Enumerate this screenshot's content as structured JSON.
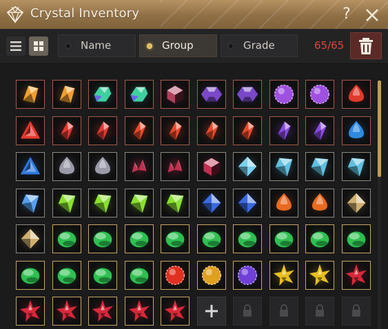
{
  "window": {
    "title": "Crystal Inventory",
    "help_label": "?",
    "icon": "diamond-gem-icon",
    "close_icon": "close-icon"
  },
  "toolbar": {
    "view_modes": [
      {
        "name": "list-view",
        "icon": "list-icon",
        "active": false
      },
      {
        "name": "grid-view",
        "icon": "grid-icon",
        "active": true
      }
    ],
    "filters": [
      {
        "label": "Name",
        "active": false
      },
      {
        "label": "Group",
        "active": true
      },
      {
        "label": "Grade",
        "active": false
      }
    ],
    "capacity": "65/65",
    "delete_icon": "trash-icon"
  },
  "colors": {
    "accent_gold": "#c09a62",
    "capacity_red": "#e0443b",
    "title_bar": "#a07f52"
  },
  "inventory": {
    "columns": 10,
    "rows": [
      [
        {
          "shape": "shard",
          "color": "#f0a030",
          "frame": "red"
        },
        {
          "shape": "shard",
          "color": "#f0a030",
          "frame": "red"
        },
        {
          "shape": "chunk",
          "color": "#3fd0a0",
          "frame": "red"
        },
        {
          "shape": "chunk",
          "color": "#3fd0a0",
          "frame": "red"
        },
        {
          "shape": "cube",
          "color": "#b0405a",
          "frame": "red"
        },
        {
          "shape": "hex",
          "color": "#7a48c8",
          "frame": "red"
        },
        {
          "shape": "hex",
          "color": "#7a48c8",
          "frame": "red"
        },
        {
          "shape": "orb",
          "color": "#a050e0",
          "frame": "red"
        },
        {
          "shape": "orb",
          "color": "#a050e0",
          "frame": "red"
        },
        {
          "shape": "drop",
          "color": "#e03a2a",
          "frame": "red"
        }
      ],
      [
        {
          "shape": "tri",
          "color": "#e8382e",
          "frame": "red"
        },
        {
          "shape": "gem",
          "color": "#e23a34",
          "frame": "red"
        },
        {
          "shape": "gem",
          "color": "#e23a34",
          "frame": "red"
        },
        {
          "shape": "gem",
          "color": "#e84a2a",
          "frame": "red"
        },
        {
          "shape": "gem",
          "color": "#e84a2a",
          "frame": "red"
        },
        {
          "shape": "gem",
          "color": "#e84a2a",
          "frame": "red"
        },
        {
          "shape": "gem",
          "color": "#e84a2a",
          "frame": "red"
        },
        {
          "shape": "gem",
          "color": "#8a4ae0",
          "frame": "red"
        },
        {
          "shape": "gem",
          "color": "#8a4ae0",
          "frame": "red"
        },
        {
          "shape": "drop",
          "color": "#2e8ae0",
          "frame": "red"
        }
      ],
      [
        {
          "shape": "tri",
          "color": "#2e7ae0",
          "frame": "gray"
        },
        {
          "shape": "drop",
          "color": "#9a9aa8",
          "frame": "gray"
        },
        {
          "shape": "drop",
          "color": "#9a9aa8",
          "frame": "gray"
        },
        {
          "shape": "cluster",
          "color": "#c03050",
          "frame": "gray"
        },
        {
          "shape": "cluster",
          "color": "#c03050",
          "frame": "gray"
        },
        {
          "shape": "cube",
          "color": "#c03050",
          "frame": "gray"
        },
        {
          "shape": "dia",
          "color": "#7ad0f0",
          "frame": "gray"
        },
        {
          "shape": "kite",
          "color": "#60c0e0",
          "frame": "gray"
        },
        {
          "shape": "kite",
          "color": "#60c0e0",
          "frame": "gray"
        },
        {
          "shape": "kite",
          "color": "#60c0e0",
          "frame": "gray"
        }
      ],
      [
        {
          "shape": "kite",
          "color": "#58a0f0",
          "frame": "gray"
        },
        {
          "shape": "kite",
          "color": "#8ae030",
          "frame": "gray"
        },
        {
          "shape": "kite",
          "color": "#8ae030",
          "frame": "gray"
        },
        {
          "shape": "kite",
          "color": "#8ae030",
          "frame": "gray"
        },
        {
          "shape": "kite",
          "color": "#8ae030",
          "frame": "gray"
        },
        {
          "shape": "dia",
          "color": "#3a6ae0",
          "frame": "gray"
        },
        {
          "shape": "dia",
          "color": "#3a6ae0",
          "frame": "gray"
        },
        {
          "shape": "drop",
          "color": "#e86a20",
          "frame": "gray"
        },
        {
          "shape": "drop",
          "color": "#e86a20",
          "frame": "gray"
        },
        {
          "shape": "dia",
          "color": "#d0b070",
          "frame": "gray"
        }
      ],
      [
        {
          "shape": "dia",
          "color": "#d0b070",
          "frame": "gray"
        },
        {
          "shape": "oval",
          "color": "#2ec050",
          "frame": "gold"
        },
        {
          "shape": "oval",
          "color": "#2ec050",
          "frame": "gold"
        },
        {
          "shape": "oval",
          "color": "#2ec050",
          "frame": "gold"
        },
        {
          "shape": "oval",
          "color": "#2ec050",
          "frame": "gold"
        },
        {
          "shape": "oval",
          "color": "#2ec050",
          "frame": "gold"
        },
        {
          "shape": "oval",
          "color": "#2ec050",
          "frame": "gold"
        },
        {
          "shape": "oval",
          "color": "#2ec050",
          "frame": "gold"
        },
        {
          "shape": "oval",
          "color": "#2ec050",
          "frame": "gold"
        },
        {
          "shape": "oval",
          "color": "#2ec050",
          "frame": "gold"
        }
      ],
      [
        {
          "shape": "oval",
          "color": "#2ec050",
          "frame": "gold"
        },
        {
          "shape": "oval",
          "color": "#2ec050",
          "frame": "gold"
        },
        {
          "shape": "oval",
          "color": "#2ec050",
          "frame": "gold"
        },
        {
          "shape": "oval",
          "color": "#2ec050",
          "frame": "gold"
        },
        {
          "shape": "orb",
          "color": "#e03020",
          "frame": "gold"
        },
        {
          "shape": "orb",
          "color": "#e0a020",
          "frame": "gold"
        },
        {
          "shape": "orb",
          "color": "#7040d8",
          "frame": "gold"
        },
        {
          "shape": "star",
          "color": "#e8c020",
          "frame": "gold"
        },
        {
          "shape": "star",
          "color": "#e8c020",
          "frame": "gold"
        },
        {
          "shape": "star",
          "color": "#d8283a",
          "frame": "gold"
        }
      ],
      [
        {
          "shape": "star",
          "color": "#d8283a",
          "frame": "gold"
        },
        {
          "shape": "star",
          "color": "#d8283a",
          "frame": "gold"
        },
        {
          "shape": "star",
          "color": "#d8283a",
          "frame": "gold"
        },
        {
          "shape": "star",
          "color": "#d8283a",
          "frame": "gold"
        },
        {
          "shape": "star",
          "color": "#d8283a",
          "frame": "gold"
        },
        {
          "shape": "add",
          "icon": "plus-icon"
        },
        {
          "shape": "locked",
          "icon": "lock-icon"
        },
        {
          "shape": "locked",
          "icon": "lock-icon"
        },
        {
          "shape": "locked",
          "icon": "lock-icon"
        },
        {
          "shape": "locked",
          "icon": "lock-icon"
        }
      ]
    ]
  }
}
